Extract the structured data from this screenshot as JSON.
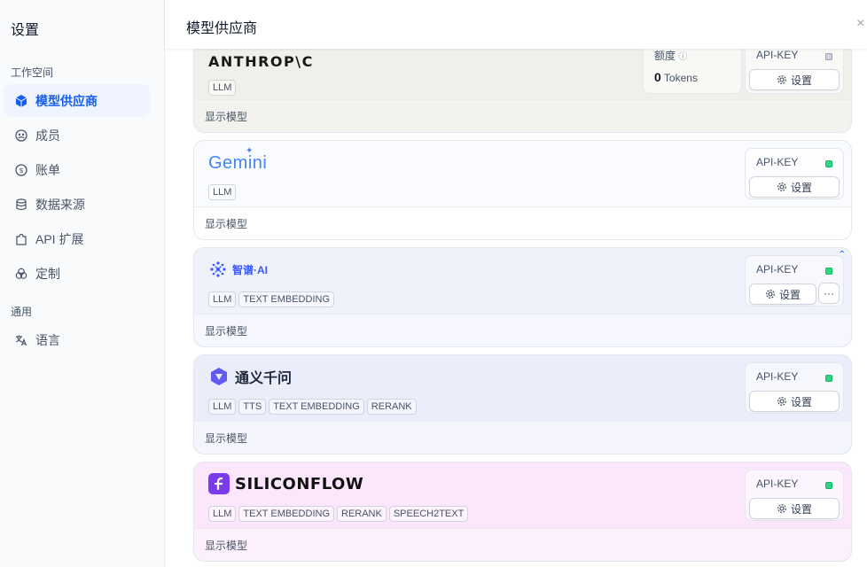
{
  "sidebar": {
    "title": "设置",
    "workspace_label": "工作空间",
    "general_label": "通用",
    "items": [
      {
        "label": "模型供应商",
        "icon": "cube-icon"
      },
      {
        "label": "成员",
        "icon": "members-icon"
      },
      {
        "label": "账单",
        "icon": "billing-icon"
      },
      {
        "label": "数据来源",
        "icon": "database-icon"
      },
      {
        "label": "API 扩展",
        "icon": "puzzle-icon"
      },
      {
        "label": "定制",
        "icon": "customize-icon"
      },
      {
        "label": "语言",
        "icon": "translate-icon"
      }
    ]
  },
  "header": {
    "title": "模型供应商",
    "close": "×"
  },
  "providers": [
    {
      "name": "ANTHROP\\C",
      "tags": [
        "LLM"
      ],
      "quota_label": "额度",
      "quota_value": "0",
      "quota_unit": "Tokens",
      "key_label": "API-KEY",
      "key_status_color": "#d0d5dd",
      "settings_label": "设置",
      "footer": "显示模型"
    },
    {
      "name": "Gemini",
      "tags": [
        "LLM"
      ],
      "key_label": "API-KEY",
      "key_status_color": "#32d583",
      "settings_label": "设置",
      "footer": "显示模型"
    },
    {
      "name": "智谱·AI",
      "tags": [
        "LLM",
        "TEXT EMBEDDING"
      ],
      "key_label": "API-KEY",
      "key_status_color": "#32d583",
      "settings_label": "设置",
      "more": "···",
      "collapse": "⌃",
      "footer": "显示模型"
    },
    {
      "name": "通义千问",
      "tags": [
        "LLM",
        "TTS",
        "TEXT EMBEDDING",
        "RERANK"
      ],
      "key_label": "API-KEY",
      "key_status_color": "#32d583",
      "settings_label": "设置",
      "footer": "显示模型"
    },
    {
      "name": "SILICONFLOW",
      "tags": [
        "LLM",
        "TEXT EMBEDDING",
        "RERANK",
        "SPEECH2TEXT"
      ],
      "key_label": "API-KEY",
      "key_status_color": "#32d583",
      "settings_label": "设置",
      "footer": "显示模型"
    }
  ],
  "colors": {
    "accent": "#155eef",
    "ok": "#32d583",
    "inactive": "#d0d5dd"
  }
}
